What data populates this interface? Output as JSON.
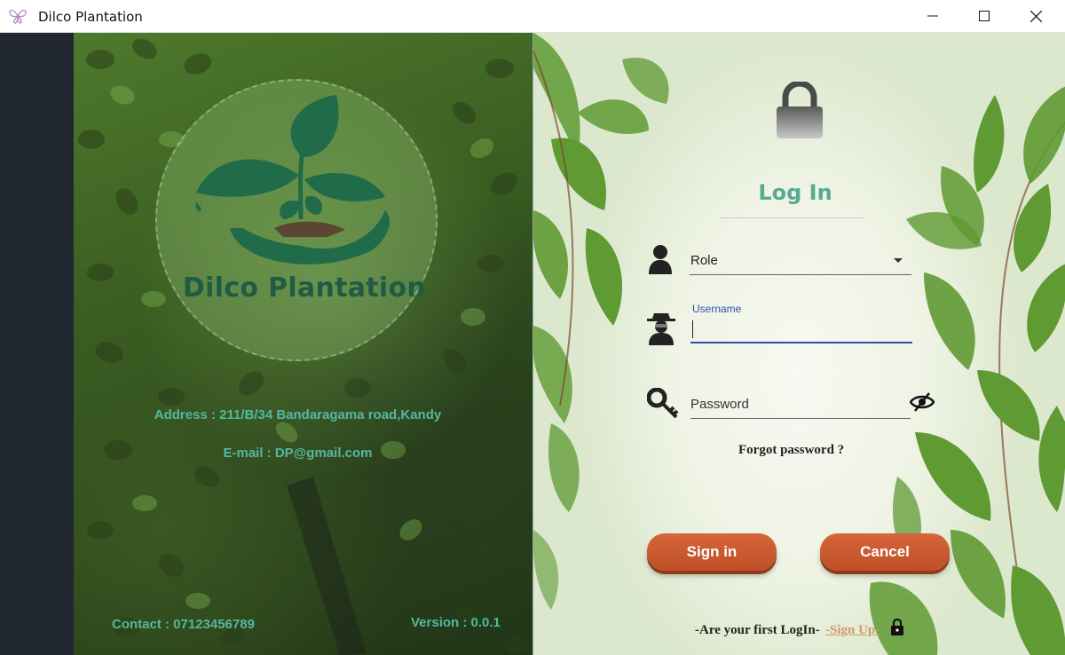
{
  "window": {
    "title": "Dilco Plantation",
    "icon": "butterfly-icon",
    "controls": [
      "minimize-icon",
      "maximize-icon",
      "close-icon"
    ]
  },
  "branding": {
    "name": "Dilco Plantation",
    "logo": "sprout-in-hand-icon",
    "address": "Address : 211/B/34 Bandaragama road,Kandy",
    "email": "E-mail : DP@gmail.com",
    "contact": "Contact : 07123456789",
    "version": "Version : 0.0.1"
  },
  "login": {
    "title": "Log In",
    "role": {
      "value": "Role",
      "icon": "user-icon"
    },
    "username": {
      "label": "Username",
      "value": "",
      "icon": "spy-icon"
    },
    "password": {
      "placeholder": "Password",
      "icon": "key-icon",
      "toggle_icon": "eye-slash-icon"
    },
    "forgot": "Forgot password ?",
    "signin_label": "Sign in",
    "cancel_label": "Cancel",
    "first_login": "-Are your first LogIn-",
    "signup_label": "-Sign Up-"
  },
  "colors": {
    "accent": "#5aaa92",
    "button": "#c9582e",
    "focus": "#2f4fa8",
    "info_text": "#54b8a0",
    "brand_text": "#1f5c45"
  }
}
